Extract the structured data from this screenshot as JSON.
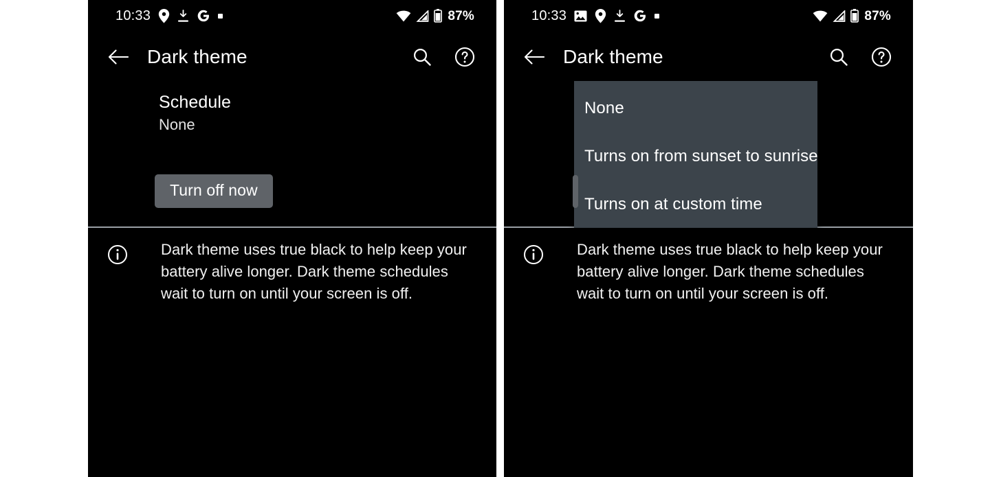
{
  "panels": {
    "left": {
      "status": {
        "time": "10:33",
        "left_icons": [
          "location-pin-icon",
          "download-icon",
          "google-g-icon",
          "dot-icon"
        ],
        "right_icons": [
          "wifi-icon",
          "signal-icon",
          "battery-icon"
        ],
        "battery_percent": "87%"
      },
      "appbar": {
        "back_icon": "back-arrow-icon",
        "title": "Dark theme",
        "search_icon": "search-icon",
        "help_icon": "help-circle-icon"
      },
      "schedule": {
        "title": "Schedule",
        "value": "None"
      },
      "turn_off_button": "Turn off now",
      "info": {
        "icon": "info-circle-icon",
        "text": "Dark theme uses true black to help keep your battery alive longer. Dark theme schedules wait to turn on until your screen is off."
      }
    },
    "right": {
      "status": {
        "time": "10:33",
        "left_icons": [
          "image-icon",
          "location-pin-icon",
          "download-icon",
          "google-g-icon",
          "dot-icon"
        ],
        "right_icons": [
          "wifi-icon",
          "signal-icon",
          "battery-icon"
        ],
        "battery_percent": "87%"
      },
      "appbar": {
        "back_icon": "back-arrow-icon",
        "title": "Dark theme",
        "search_icon": "search-icon",
        "help_icon": "help-circle-icon"
      },
      "dropdown": {
        "options": [
          "None",
          "Turns on from sunset to sunrise",
          "Turns on at custom time"
        ],
        "selected": "None"
      },
      "info": {
        "icon": "info-circle-icon",
        "text": "Dark theme uses true black to help keep your battery alive longer. Dark theme schedules wait to turn on until your screen is off."
      }
    }
  },
  "colors": {
    "background": "#000000",
    "page": "#ffffff",
    "button": "#5f6368",
    "menu": "#3c444b",
    "divider": "#9aa0a6",
    "text": "#ffffff"
  }
}
